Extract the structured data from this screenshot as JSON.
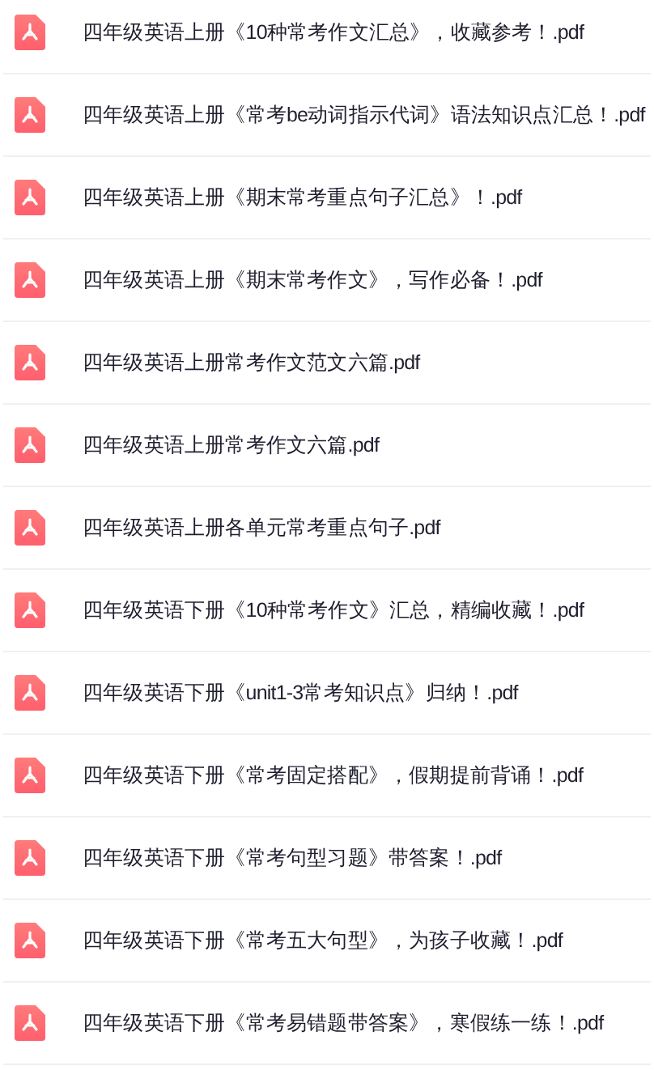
{
  "files": [
    {
      "name": "四年级英语上册《10种常考作文汇总》，收藏参考！.pdf"
    },
    {
      "name": "四年级英语上册《常考be动词指示代词》语法知识点汇总！.pdf"
    },
    {
      "name": "四年级英语上册《期末常考重点句子汇总》！.pdf"
    },
    {
      "name": "四年级英语上册《期末常考作文》，写作必备！.pdf"
    },
    {
      "name": "四年级英语上册常考作文范文六篇.pdf"
    },
    {
      "name": "四年级英语上册常考作文六篇.pdf"
    },
    {
      "name": "四年级英语上册各单元常考重点句子.pdf"
    },
    {
      "name": "四年级英语下册《10种常考作文》汇总，精编收藏！.pdf"
    },
    {
      "name": "四年级英语下册《unit1-3常考知识点》归纳！.pdf"
    },
    {
      "name": "四年级英语下册《常考固定搭配》，假期提前背诵！.pdf"
    },
    {
      "name": "四年级英语下册《常考句型习题》带答案！.pdf"
    },
    {
      "name": "四年级英语下册《常考五大句型》，为孩子收藏！.pdf"
    },
    {
      "name": "四年级英语下册《常考易错题带答案》，寒假练一练！.pdf"
    }
  ]
}
